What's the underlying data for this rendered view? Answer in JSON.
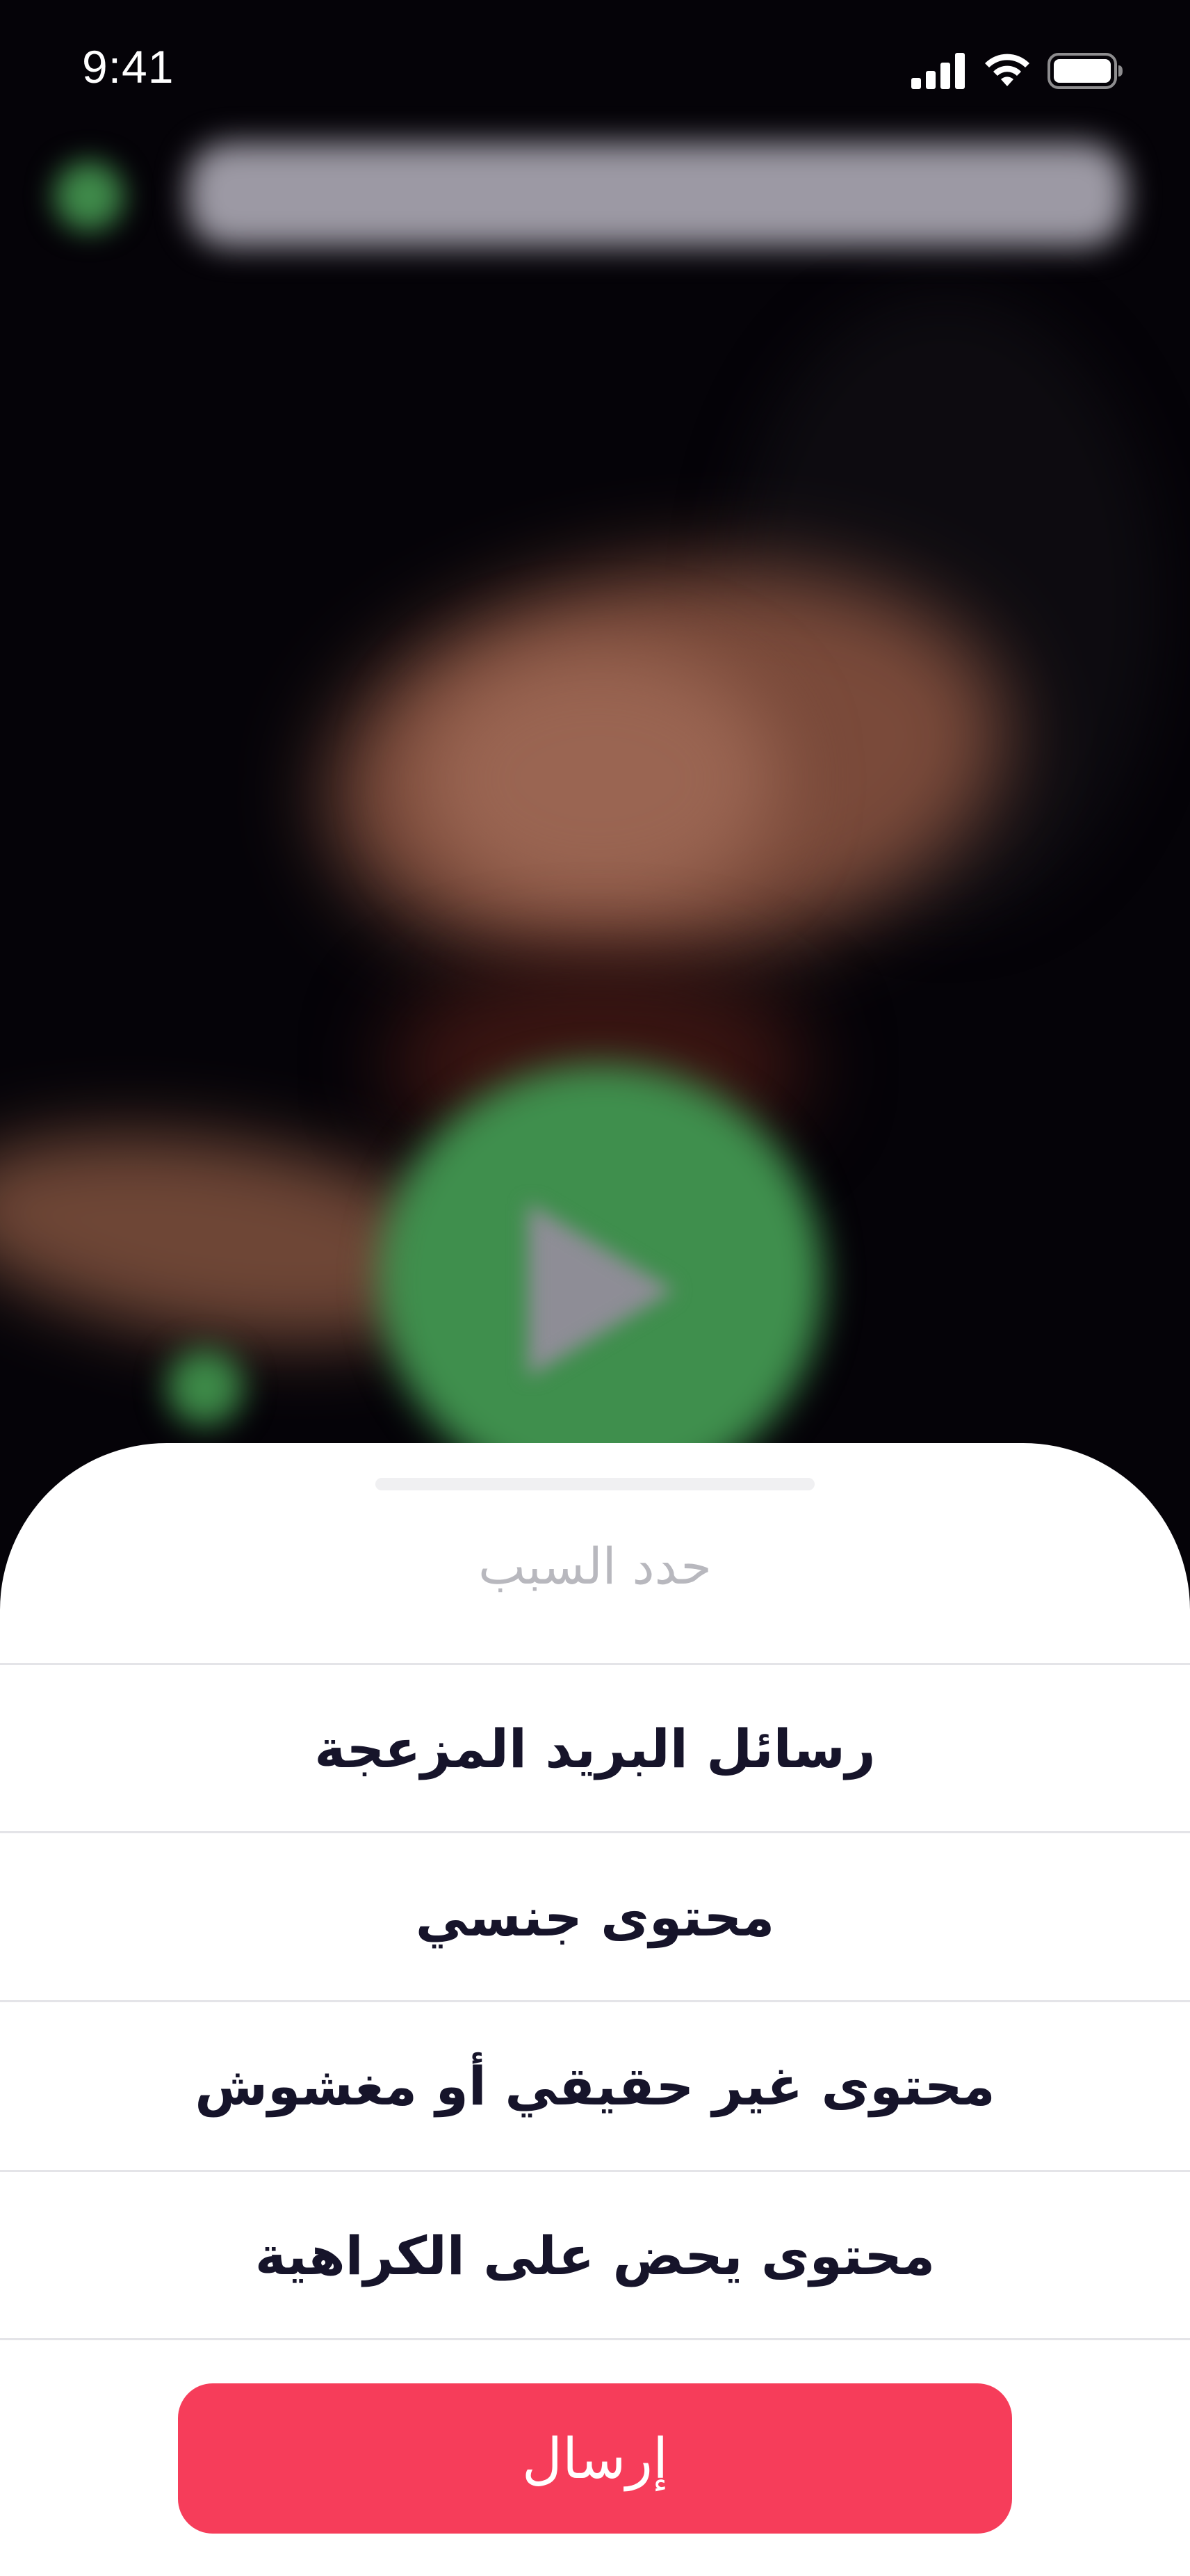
{
  "status_bar": {
    "time": "9:41",
    "icons": [
      "cellular-signal-icon",
      "wifi-icon",
      "battery-icon"
    ]
  },
  "background": {
    "description_icons": [
      "avatar",
      "video-title",
      "play-icon"
    ]
  },
  "report_sheet": {
    "title": "حدد السبب",
    "options": [
      {
        "label": "رسائل البريد المزعجة"
      },
      {
        "label": "محتوى جنسي"
      },
      {
        "label": "محتوى غير حقيقي أو مغشوش"
      },
      {
        "label": "محتوى يحض على الكراهية"
      }
    ],
    "submit_label": "إرسال"
  },
  "colors": {
    "accent": "#F63D5A",
    "option_text": "#16142A",
    "title_text": "#B8B8BE",
    "divider": "#E4E4E8"
  }
}
